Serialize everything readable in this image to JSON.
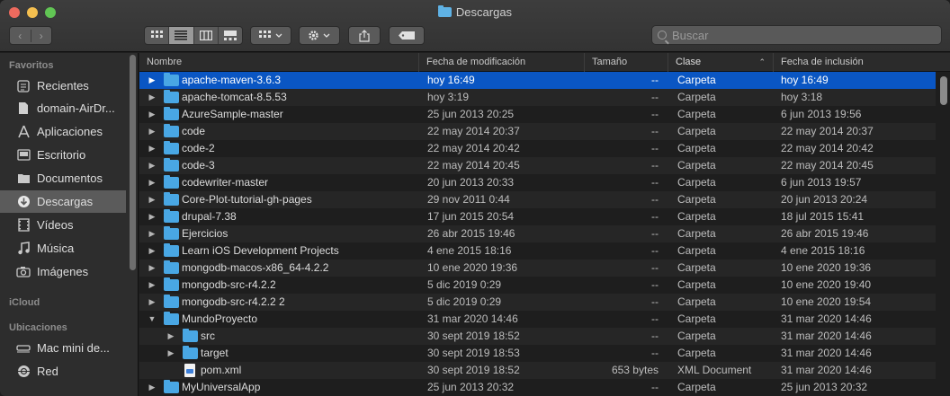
{
  "window": {
    "title": "Descargas"
  },
  "toolbar": {
    "search_placeholder": "Buscar"
  },
  "sidebar": {
    "favorites_heading": "Favoritos",
    "favorites": [
      {
        "label": "Recientes",
        "icon": "recents-icon"
      },
      {
        "label": "domain-AirDr...",
        "icon": "document-icon"
      },
      {
        "label": "Aplicaciones",
        "icon": "applications-icon"
      },
      {
        "label": "Escritorio",
        "icon": "desktop-icon"
      },
      {
        "label": "Documentos",
        "icon": "documents-icon"
      },
      {
        "label": "Descargas",
        "icon": "downloads-icon",
        "active": true
      },
      {
        "label": "Vídeos",
        "icon": "movies-icon"
      },
      {
        "label": "Música",
        "icon": "music-icon"
      },
      {
        "label": "Imágenes",
        "icon": "pictures-icon"
      }
    ],
    "icloud_heading": "iCloud",
    "locations_heading": "Ubicaciones",
    "locations": [
      {
        "label": "Mac mini de...",
        "icon": "computer-icon"
      },
      {
        "label": "Red",
        "icon": "network-icon"
      }
    ]
  },
  "columns": {
    "name": "Nombre",
    "modified": "Fecha de modificación",
    "size": "Tamaño",
    "kind": "Clase",
    "added": "Fecha de inclusión"
  },
  "rows": [
    {
      "name": "apache-maven-3.6.3",
      "modified": "hoy 16:49",
      "size": "--",
      "kind": "Carpeta",
      "added": "hoy 16:49",
      "type": "folder",
      "level": 0,
      "expanded": false,
      "selected": true
    },
    {
      "name": "apache-tomcat-8.5.53",
      "modified": "hoy 3:19",
      "size": "--",
      "kind": "Carpeta",
      "added": "hoy 3:18",
      "type": "folder",
      "level": 0,
      "expanded": false
    },
    {
      "name": "AzureSample-master",
      "modified": "25 jun 2013 20:25",
      "size": "--",
      "kind": "Carpeta",
      "added": "6 jun 2013 19:56",
      "type": "folder",
      "level": 0,
      "expanded": false
    },
    {
      "name": "code",
      "modified": "22 may 2014 20:37",
      "size": "--",
      "kind": "Carpeta",
      "added": "22 may 2014 20:37",
      "type": "folder",
      "level": 0,
      "expanded": false
    },
    {
      "name": "code-2",
      "modified": "22 may 2014 20:42",
      "size": "--",
      "kind": "Carpeta",
      "added": "22 may 2014 20:42",
      "type": "folder",
      "level": 0,
      "expanded": false
    },
    {
      "name": "code-3",
      "modified": "22 may 2014 20:45",
      "size": "--",
      "kind": "Carpeta",
      "added": "22 may 2014 20:45",
      "type": "folder",
      "level": 0,
      "expanded": false
    },
    {
      "name": "codewriter-master",
      "modified": "20 jun 2013 20:33",
      "size": "--",
      "kind": "Carpeta",
      "added": "6 jun 2013 19:57",
      "type": "folder",
      "level": 0,
      "expanded": false
    },
    {
      "name": "Core-Plot-tutorial-gh-pages",
      "modified": "29 nov 2011 0:44",
      "size": "--",
      "kind": "Carpeta",
      "added": "20 jun 2013 20:24",
      "type": "folder",
      "level": 0,
      "expanded": false
    },
    {
      "name": "drupal-7.38",
      "modified": "17 jun 2015 20:54",
      "size": "--",
      "kind": "Carpeta",
      "added": "18 jul 2015 15:41",
      "type": "folder",
      "level": 0,
      "expanded": false
    },
    {
      "name": "Ejercicios",
      "modified": "26 abr 2015 19:46",
      "size": "--",
      "kind": "Carpeta",
      "added": "26 abr 2015 19:46",
      "type": "folder",
      "level": 0,
      "expanded": false
    },
    {
      "name": "Learn iOS Development Projects",
      "modified": "4 ene 2015 18:16",
      "size": "--",
      "kind": "Carpeta",
      "added": "4 ene 2015 18:16",
      "type": "folder",
      "level": 0,
      "expanded": false
    },
    {
      "name": "mongodb-macos-x86_64-4.2.2",
      "modified": "10 ene 2020 19:36",
      "size": "--",
      "kind": "Carpeta",
      "added": "10 ene 2020 19:36",
      "type": "folder",
      "level": 0,
      "expanded": false
    },
    {
      "name": "mongodb-src-r4.2.2",
      "modified": "5 dic 2019 0:29",
      "size": "--",
      "kind": "Carpeta",
      "added": "10 ene 2020 19:40",
      "type": "folder",
      "level": 0,
      "expanded": false
    },
    {
      "name": "mongodb-src-r4.2.2 2",
      "modified": "5 dic 2019 0:29",
      "size": "--",
      "kind": "Carpeta",
      "added": "10 ene 2020 19:54",
      "type": "folder",
      "level": 0,
      "expanded": false
    },
    {
      "name": "MundoProyecto",
      "modified": "31 mar 2020 14:46",
      "size": "--",
      "kind": "Carpeta",
      "added": "31 mar 2020 14:46",
      "type": "folder",
      "level": 0,
      "expanded": true
    },
    {
      "name": "src",
      "modified": "30 sept 2019 18:52",
      "size": "--",
      "kind": "Carpeta",
      "added": "31 mar 2020 14:46",
      "type": "folder",
      "level": 1,
      "expanded": false
    },
    {
      "name": "target",
      "modified": "30 sept 2019 18:53",
      "size": "--",
      "kind": "Carpeta",
      "added": "31 mar 2020 14:46",
      "type": "folder",
      "level": 1,
      "expanded": false
    },
    {
      "name": "pom.xml",
      "modified": "30 sept 2019 18:52",
      "size": "653 bytes",
      "kind": "XML Document",
      "added": "31 mar 2020 14:46",
      "type": "file",
      "level": 1
    },
    {
      "name": "MyUniversalApp",
      "modified": "25 jun 2013 20:32",
      "size": "--",
      "kind": "Carpeta",
      "added": "25 jun 2013 20:32",
      "type": "folder",
      "level": 0,
      "expanded": false
    }
  ]
}
